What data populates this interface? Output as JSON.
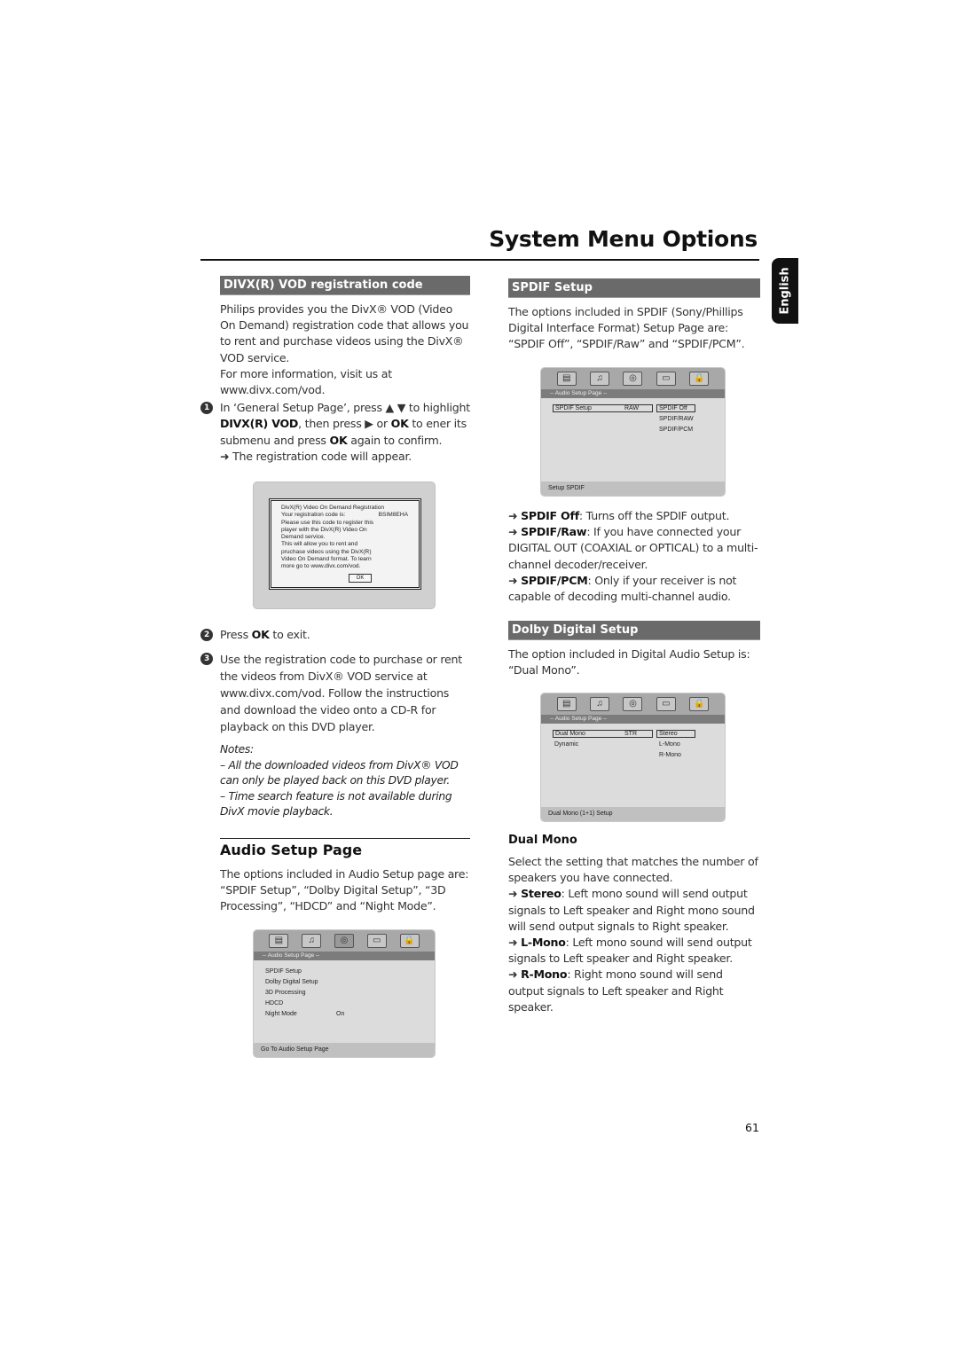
{
  "header": {
    "title": "System Menu Options",
    "language_tab": "English"
  },
  "divx": {
    "section_title": "DIVX(R) VOD registration code",
    "intro": "Philips provides you the DivX® VOD (Video On Demand) registration code that allows you to rent and purchase videos using the DivX® VOD service.",
    "more_info": "For more information, visit us at www.divx.com/vod.",
    "steps": [
      {
        "num": "1",
        "parts": {
          "a": "In ‘General Setup Page’, press ▲ ▼ to highlight ",
          "b": "DIVX(R) VOD",
          "c": ", then press ▶ or ",
          "d": "OK",
          "e": " to ener its submenu and press ",
          "f": "OK",
          "g": " again to confirm."
        },
        "result": "The registration code will appear."
      },
      {
        "num": "2",
        "parts": {
          "a": "Press ",
          "b": "OK",
          "c": " to exit."
        }
      },
      {
        "num": "3",
        "text": "Use the registration code to purchase or rent the videos from DivX® VOD service at www.divx.com/vod. Follow the instructions and download the video onto a CD-R for playback on this DVD player."
      }
    ],
    "dialog": {
      "title": "DivX(R) Video On Demand Registration",
      "code_label": "Your registration code is:",
      "code_value": "BSIM8EHA",
      "lines": [
        "Please use this code to register this",
        "player with the DivX(R) Video On",
        "Demand service.",
        "This will allow you to rent and",
        "pruchase videos using the DivX(R)",
        "Video On Demand format. To learn",
        "more go to www.divx.com/vod."
      ],
      "ok_button": "OK"
    },
    "notes_title": "Notes:",
    "notes": [
      "–  All the downloaded videos from DivX® VOD can only be played back on this DVD player.",
      "–  Time search feature is not available during DivX movie playback."
    ]
  },
  "audio_setup": {
    "title": "Audio Setup Page",
    "intro": "The options included in Audio Setup page are: “SPDIF Setup”, “Dolby Digital Setup”, “3D Processing”, “HDCD” and “Night Mode”.",
    "screen": {
      "page_label": "-- Audio Setup Page --",
      "items": [
        "SPDIF Setup",
        "Dolby Digital Setup",
        "3D Processing",
        "HDCD",
        "Night Mode"
      ],
      "night_mode_value": "On",
      "footer": "Go To Audio Setup Page"
    }
  },
  "spdif": {
    "section_title": "SPDIF Setup",
    "intro": "The options included in SPDIF (Sony/Phillips Digital Interface Format) Setup Page are: “SPDIF Off”, “SPDIF/Raw” and “SPDIF/PCM”.",
    "screen": {
      "page_label": "-- Audio Setup Page --",
      "item": "SPDIF Setup",
      "item_value": "RAW",
      "options": [
        "SPDIF Off",
        "SPDIF/RAW",
        "SPDIF/PCM"
      ],
      "footer": "Setup SPDIF"
    },
    "options": [
      {
        "label": "SPDIF Off",
        "desc": ": Turns off the SPDIF output."
      },
      {
        "label": "SPDIF/Raw",
        "desc": ": If you have connected your DIGITAL OUT (COAXIAL or OPTICAL) to a multi-channel decoder/receiver."
      },
      {
        "label": "SPDIF/PCM",
        "desc": ": Only if your receiver is not capable of decoding multi-channel audio."
      }
    ]
  },
  "dolby": {
    "section_title": "Dolby Digital Setup",
    "intro": "The option included in Digital Audio Setup is: “Dual Mono”.",
    "screen": {
      "page_label": "-- Audio Setup Page --",
      "item": "Dual Mono",
      "item_value": "STR",
      "item2": "Dynamic",
      "options": [
        "Stereo",
        "L-Mono",
        "R-Mono"
      ],
      "footer": "Dual Mono (1+1) Setup"
    }
  },
  "dual_mono": {
    "title": "Dual Mono",
    "intro": "Select the setting that matches the number of speakers you have connected.",
    "options": [
      {
        "label": "Stereo",
        "desc": ": Left mono sound will send output signals to Left speaker and Right mono sound will send output signals to Right speaker."
      },
      {
        "label": "L-Mono",
        "desc": ": Left mono sound will send output signals to Left speaker and Right speaker."
      },
      {
        "label": "R-Mono",
        "desc": ": Right mono sound will send output signals to Left speaker and Right speaker."
      }
    ]
  },
  "screen_icons": [
    "general-setup-icon",
    "audio-setup-icon",
    "dolby-setup-icon",
    "video-setup-icon",
    "preference-lock-icon"
  ],
  "arrow_glyph": "➜",
  "page_number": "61"
}
